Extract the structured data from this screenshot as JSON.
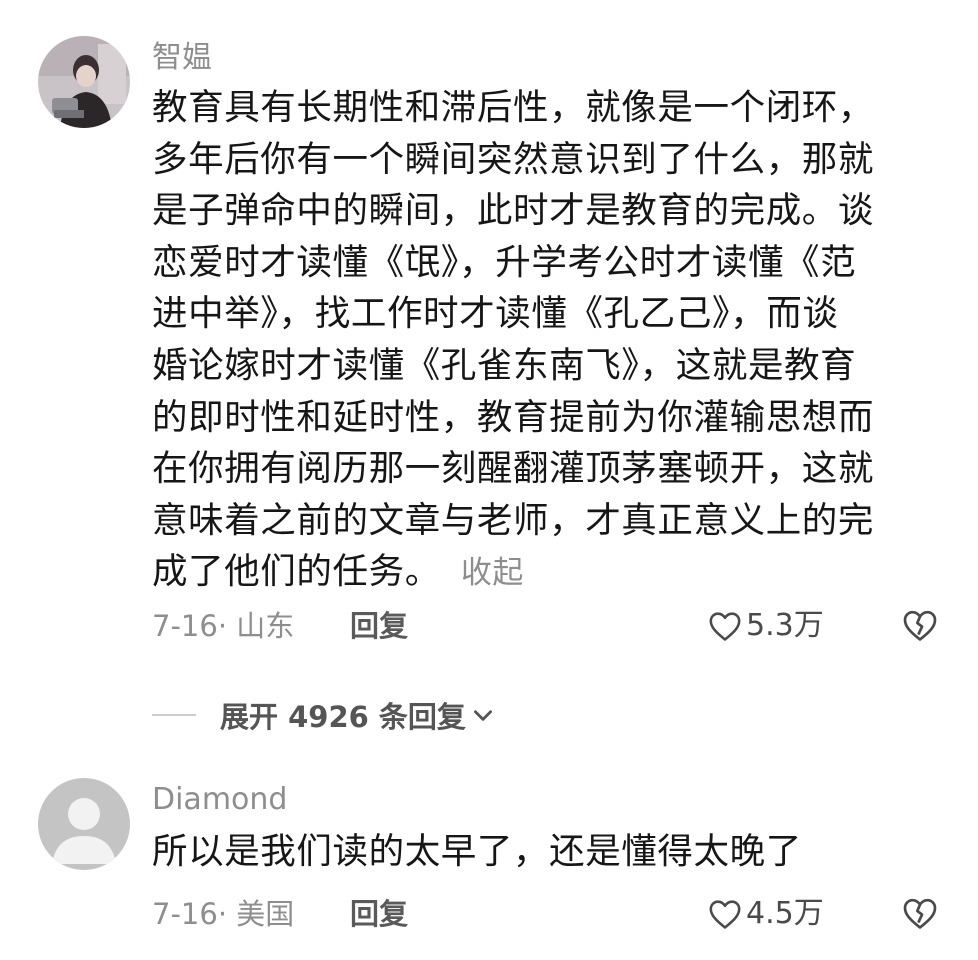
{
  "comments": [
    {
      "username": "智媪",
      "body_lines": [
        "教育具有长期性和滞后性，就像是一个闭环，",
        "多年后你有一个瞬间突然意识到了什么，那就",
        "是子弹命中的瞬间，此时才是教育的完成。谈",
        "恋爱时才读懂《氓》，升学考公时才读懂《范",
        "进中举》，找工作时才读懂《孔乙己》，而谈",
        "婚论嫁时才读懂《孔雀东南飞》，这就是教育",
        "的即时性和延时性，教育提前为你灌输思想而",
        "在你拥有阅历那一刻醒翻灌顶茅塞顿开，这就",
        "意味着之前的文章与老师，才真正意义上的完",
        "成了他们的任务。"
      ],
      "collapse_label": "收起",
      "date_location": "7-16· 山东",
      "reply_label": "回复",
      "like_count": "5.3万"
    },
    {
      "username": "Diamond",
      "body_lines": [
        "所以是我们读的太早了，还是懂得太晚了"
      ],
      "date_location": "7-16· 美国",
      "reply_label": "回复",
      "like_count": "4.5万"
    }
  ],
  "expand_replies_label": "展开 4926 条回复",
  "icons": {
    "like": "heart-outline-icon",
    "dislike": "broken-heart-icon",
    "expand": "chevron-down-icon"
  },
  "colors": {
    "text_primary": "#161616",
    "text_secondary": "#8e8e8e",
    "background": "#ffffff"
  }
}
